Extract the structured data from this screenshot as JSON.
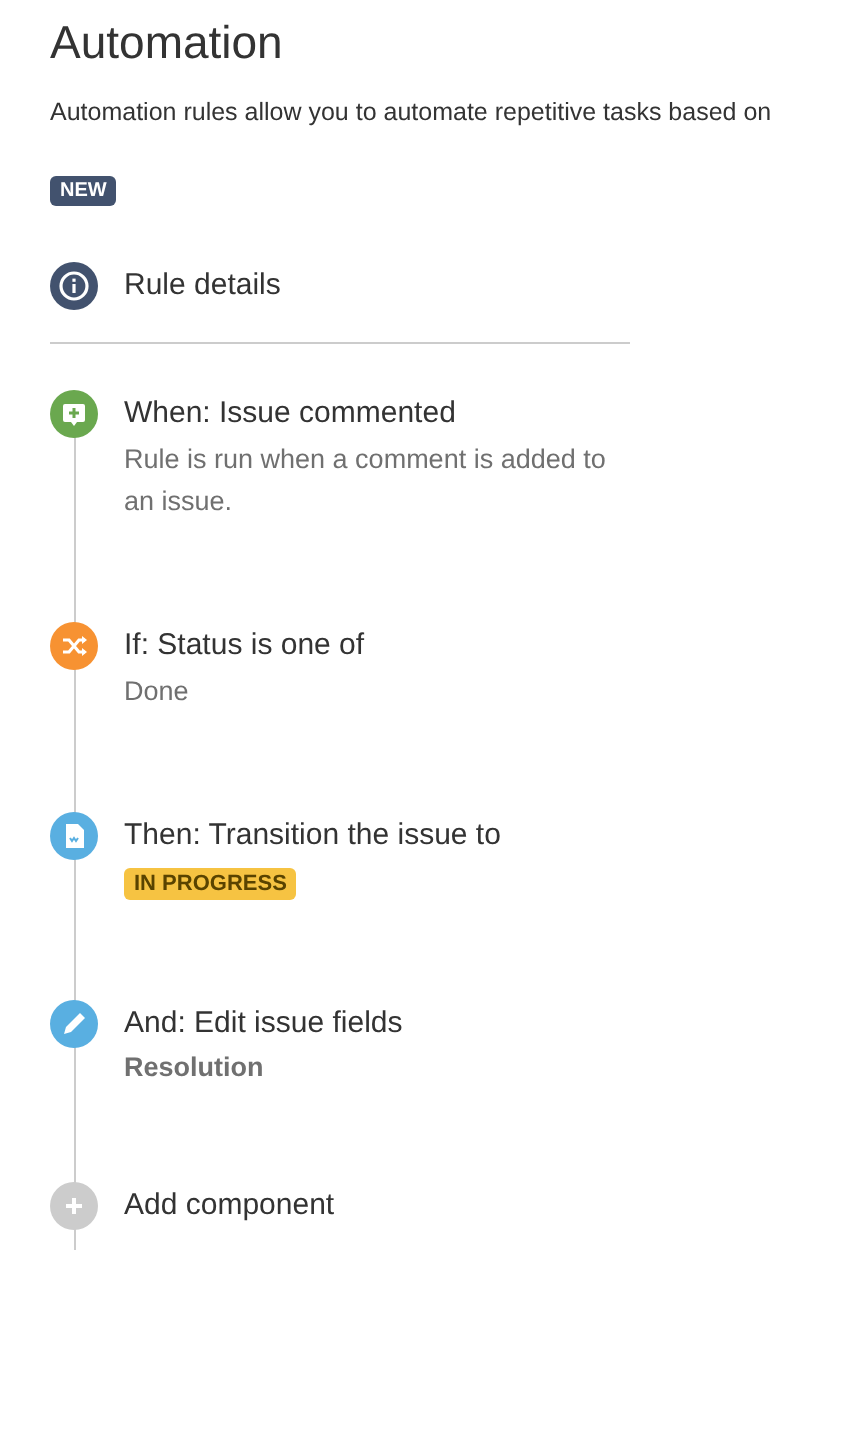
{
  "title": "Automation",
  "description": "Automation rules allow you to automate repetitive tasks based on",
  "badge": "NEW",
  "rule_details": {
    "label": "Rule details"
  },
  "steps": [
    {
      "kind": "trigger",
      "color": "#6aa84f",
      "title": "When: Issue commented",
      "detail": {
        "kind": "text",
        "text": "Rule is run when a comment is added to an issue."
      }
    },
    {
      "kind": "condition",
      "color": "#f79232",
      "title": "If: Status is one of",
      "detail": {
        "kind": "text",
        "text": "Done"
      }
    },
    {
      "kind": "action",
      "color": "#59afe1",
      "title": "Then: Transition the issue to",
      "detail": {
        "kind": "lozenge",
        "text": "IN PROGRESS"
      }
    },
    {
      "kind": "edit",
      "color": "#59afe1",
      "title": "And: Edit issue fields",
      "detail": {
        "kind": "bold",
        "text": "Resolution"
      }
    },
    {
      "kind": "add",
      "color": "#cccccc",
      "title": "Add component"
    }
  ]
}
